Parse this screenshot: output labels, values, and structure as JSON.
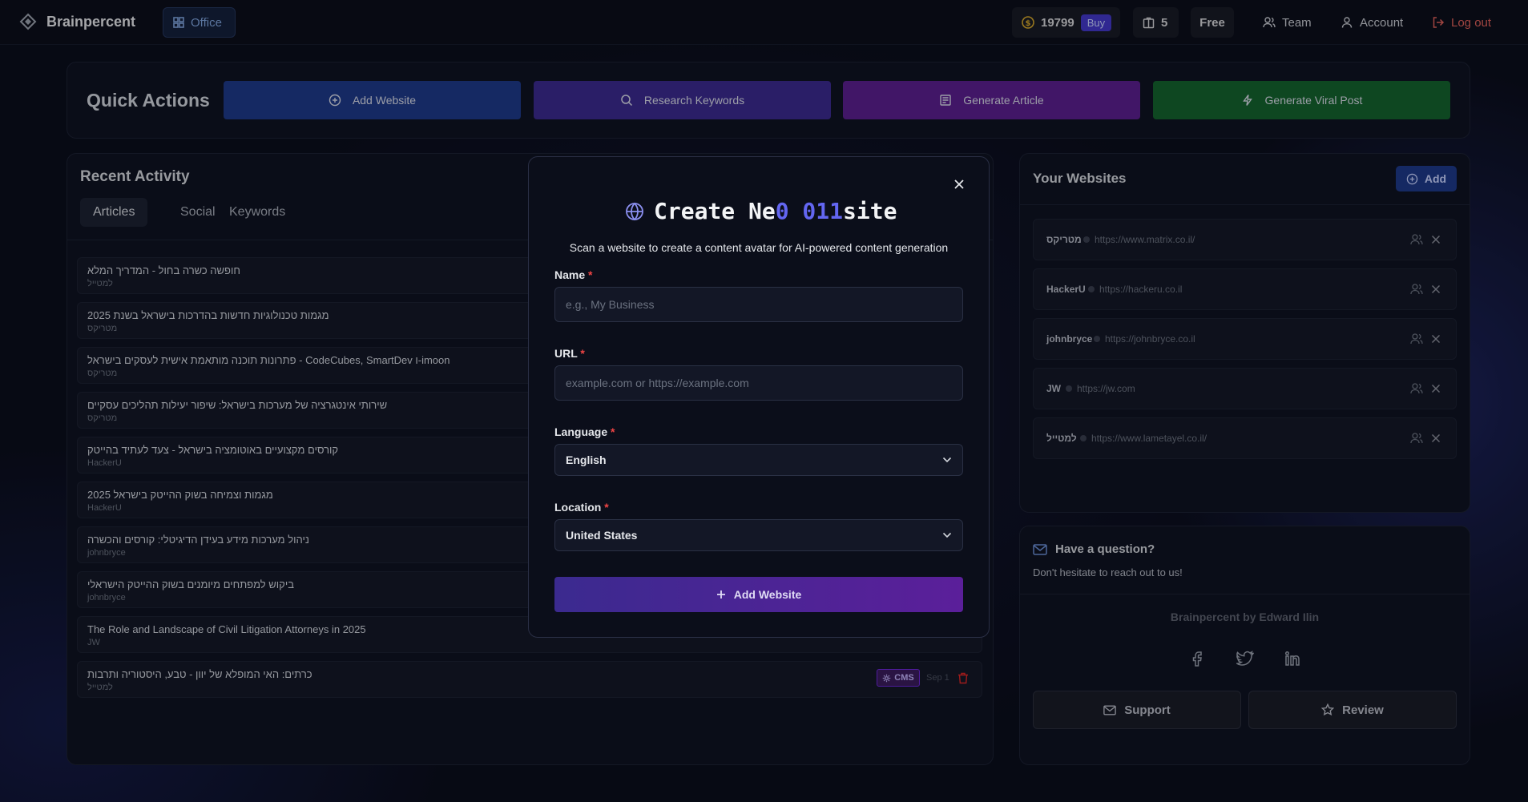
{
  "header": {
    "brand": "Brainpercent",
    "office_label": "Office",
    "credits": "19799",
    "buy_label": "Buy",
    "boxes_count": "5",
    "plan": "Free",
    "team_label": "Team",
    "account_label": "Account",
    "logout_label": "Log out"
  },
  "quick_actions": {
    "title": "Quick Actions",
    "buttons": [
      {
        "label": "Add Website",
        "icon": "plus-circle-icon",
        "color": "#1e3a8a"
      },
      {
        "label": "Research Keywords",
        "icon": "search-icon",
        "color": "#3b2a8f"
      },
      {
        "label": "Generate Article",
        "icon": "newspaper-icon",
        "color": "#5b1f8f"
      },
      {
        "label": "Generate Viral Post",
        "icon": "lightning-icon",
        "color": "#14632f"
      }
    ]
  },
  "recent_activity": {
    "title": "Recent Activity",
    "tabs": [
      "Articles",
      "Social",
      "Keywords"
    ],
    "active_tab": "Articles",
    "items": [
      {
        "title": "חופשה כשרה בחול - המדריך המלא",
        "site": "למטייל"
      },
      {
        "title": "2025 מגמות טכנולוגיות חדשות בהדרכות בישראל בשנת",
        "site": "מטריקס"
      },
      {
        "title": "פתרונות תוכנה מותאמת אישית לעסקים בישראל - CodeCubes, SmartDev ו-imoon",
        "site": "מטריקס"
      },
      {
        "title": "שירותי אינטגרציה של מערכות בישראל: שיפור יעילות תהליכים עסקיים",
        "site": "מטריקס"
      },
      {
        "title": "קורסים מקצועיים באוטומציה בישראל - צעד לעתיד בהייטק",
        "site": "HackerU"
      },
      {
        "title": "2025 מגמות וצמיחה בשוק ההייטק בישראל",
        "site": "HackerU"
      },
      {
        "title": "ניהול מערכות מידע בעידן הדיגיטלי: קורסים והכשרה",
        "site": "johnbryce"
      },
      {
        "title": "ביקוש למפתחים מיומנים בשוק ההייטק הישראלי",
        "site": "johnbryce"
      },
      {
        "title": "The Role and Landscape of Civil Litigation Attorneys in 2025",
        "site": "JW"
      },
      {
        "title": "כרתים: האי המופלא של יוון - טבע, היסטוריה ותרבות",
        "site": "למטייל"
      }
    ],
    "last_item_badge": "CMS",
    "last_item_date": "Sep 1"
  },
  "websites": {
    "title": "Your Websites",
    "add_label": "Add",
    "items": [
      {
        "name": "מטריקס",
        "url": "https://www.matrix.co.il/"
      },
      {
        "name": "HackerU",
        "url": "https://hackeru.co.il"
      },
      {
        "name": "johnbryce",
        "url": "https://johnbryce.co.il"
      },
      {
        "name": "JW",
        "url": "https://jw.com"
      },
      {
        "name": "למטייל",
        "url": "https://www.lametayel.co.il/"
      }
    ]
  },
  "question": {
    "title": "Have a question?",
    "subtitle": "Don't hesitate to reach out to us!",
    "credit": "Brainpercent by Edward Ilin",
    "social_icons": [
      "facebook-icon",
      "twitter-icon",
      "linkedin-icon"
    ],
    "support_label": "Support",
    "review_label": "Review"
  },
  "modal": {
    "title_part1": "Create Ne",
    "title_glitch": "0 011",
    "title_part2": "site",
    "subtitle": "Scan a website to create a content avatar for AI-powered content generation",
    "name_label": "Name",
    "name_placeholder": "e.g., My Business",
    "url_label": "URL",
    "url_placeholder": "example.com or https://example.com",
    "language_label": "Language",
    "language_value": "English",
    "location_label": "Location",
    "location_value": "United States",
    "required_mark": "*",
    "submit_label": "Add Website"
  }
}
